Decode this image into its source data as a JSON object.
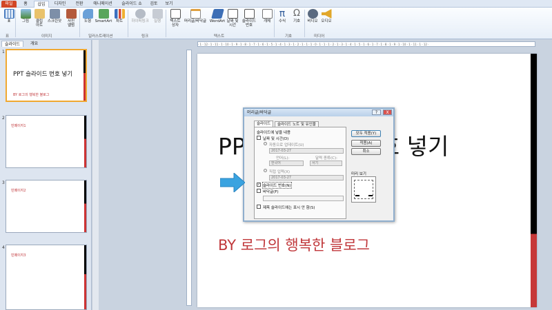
{
  "tabs": [
    "파일",
    "홈",
    "삽입",
    "디자인",
    "전환",
    "애니메이션",
    "슬라이드 쇼",
    "검토",
    "보기"
  ],
  "ribbon": {
    "buttons": [
      "표",
      "그림",
      "클립\n아트",
      "스크린샷",
      "사진\n앨범",
      "도형",
      "SmartArt",
      "차트",
      "하이퍼링크",
      "실행",
      "텍스트\n상자",
      "머리글/바닥글",
      "WordArt",
      "날짜 및\n시간",
      "슬라이드\n번호",
      "개체",
      "수식",
      "기호",
      "비디오",
      "오디오"
    ],
    "groups": [
      "표",
      "이미지",
      "일러스트레이션",
      "링크",
      "텍스트",
      "기호",
      "미디어"
    ]
  },
  "left_pane": {
    "tabs": [
      "슬라이드",
      "개요"
    ],
    "slides": [
      {
        "num": "1",
        "title": "PPT 슬라이드 번호 넣기",
        "sub": "BY 로그의 행복한 블로그"
      },
      {
        "num": "2",
        "title": "",
        "sub": "빈페이지1"
      },
      {
        "num": "3",
        "title": "",
        "sub": "빈페이지2"
      },
      {
        "num": "4",
        "title": "",
        "sub": "빈페이지3"
      }
    ]
  },
  "ruler_text": "· 1 · 12 · 1 · 11 · 1 · 10 · 1 · 9 · 1 · 8 · 1 · 7 · 1 · 6 · 1 · 5 · 1 · 4 · 1 · 3 · 1 · 2 · 1 · 1 · 1 · 0 · 1 · 1 · 1 · 2 · 1 · 3 · 1 · 4 · 1 · 5 · 1 · 6 · 1 · 7 · 1 · 8 · 1 · 9 · 1 · 10 · 1 · 11 · 1 · 12 ·",
  "slide": {
    "title": "PPT 슬라이드 번호 넣기",
    "subtitle": "BY 로그의 행복한 블로그"
  },
  "dialog": {
    "title": "머리글/바닥글",
    "help": "?",
    "close": "X",
    "tabs": [
      "슬라이드",
      "슬라이드 노트 및 유인물"
    ],
    "section_label": "슬라이드에 넣을 내용",
    "date_time": "날짜 및 시간(D)",
    "auto_update": "자동으로 업데이트(U)",
    "auto_date": "2017-03-27",
    "language_label": "언어(L):",
    "calendar_label": "달력 종류(C):",
    "language_value": "한국어",
    "calendar_value": "서기",
    "fixed": "직접 입력(X)",
    "fixed_date": "2017-03-27",
    "slide_number": "슬라이드 번호(N)",
    "slide_number_checked": "✓",
    "footer": "바닥글(F)",
    "no_title": "제목 슬라이드에는 표시 안 함(S)",
    "btn_apply_all": "모두 적용(Y)",
    "btn_apply": "적용(A)",
    "btn_cancel": "취소",
    "preview_label": "미리 보기"
  },
  "colors": {
    "accent_red": "#c0373a",
    "arrow": "#3aa3e0",
    "file_tab": "#d24726"
  }
}
